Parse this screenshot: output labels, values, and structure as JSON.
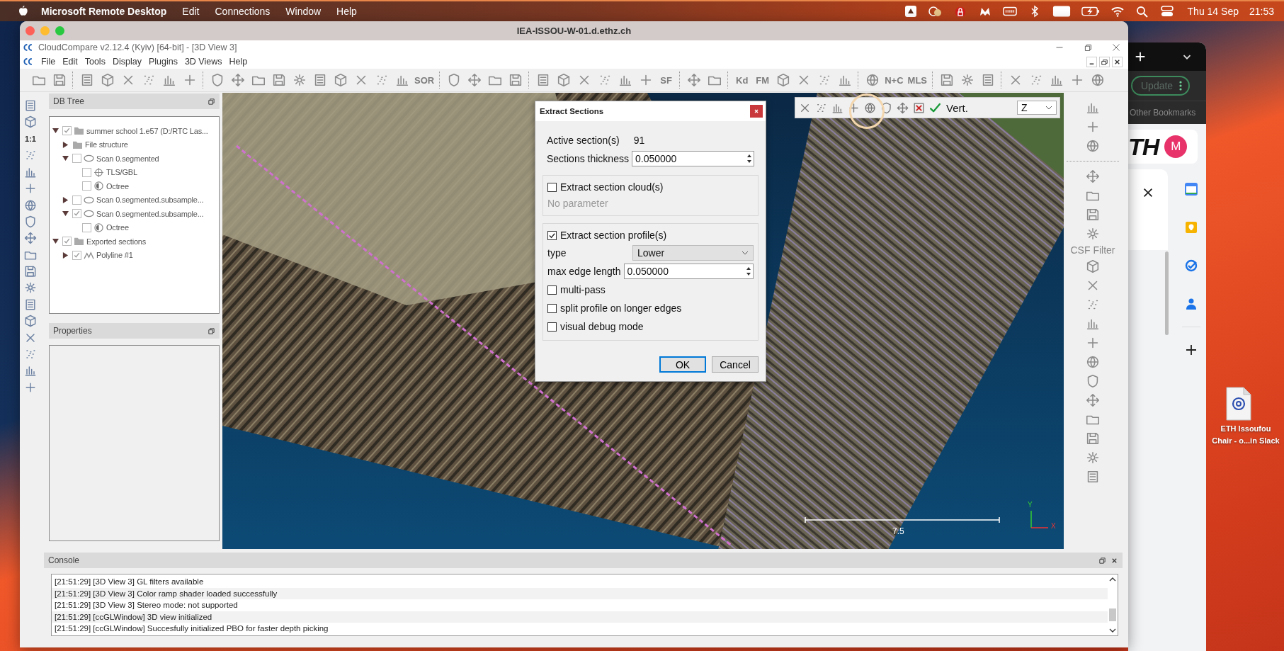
{
  "menu_bar": {
    "app": "Microsoft Remote Desktop",
    "menus": [
      "Edit",
      "Connections",
      "Window",
      "Help"
    ],
    "date": "Thu 14 Sep",
    "time": "21:53"
  },
  "remote_window": {
    "title": "IEA-ISSOU-W-01.d.ethz.ch"
  },
  "app": {
    "title": "CloudCompare v2.12.4 (Kyiv) [64-bit] - [3D View 3]",
    "menus": [
      "File",
      "Edit",
      "Tools",
      "Display",
      "Plugins",
      "3D Views",
      "Help"
    ]
  },
  "main_toolbar": [
    {
      "kind": "icon"
    },
    {
      "kind": "icon"
    },
    {
      "kind": "sep"
    },
    {
      "kind": "icon"
    },
    {
      "kind": "icon"
    },
    {
      "kind": "icon"
    },
    {
      "kind": "icon"
    },
    {
      "kind": "icon"
    },
    {
      "kind": "icon"
    },
    {
      "kind": "sep"
    },
    {
      "kind": "icon"
    },
    {
      "kind": "icon"
    },
    {
      "kind": "icon"
    },
    {
      "kind": "icon"
    },
    {
      "kind": "icon"
    },
    {
      "kind": "icon"
    },
    {
      "kind": "icon"
    },
    {
      "kind": "icon"
    },
    {
      "kind": "icon"
    },
    {
      "kind": "icon"
    },
    {
      "kind": "text",
      "label": "SOR"
    },
    {
      "kind": "sep"
    },
    {
      "kind": "icon"
    },
    {
      "kind": "icon"
    },
    {
      "kind": "icon"
    },
    {
      "kind": "icon"
    },
    {
      "kind": "sep"
    },
    {
      "kind": "icon"
    },
    {
      "kind": "icon"
    },
    {
      "kind": "icon"
    },
    {
      "kind": "icon"
    },
    {
      "kind": "icon"
    },
    {
      "kind": "icon"
    },
    {
      "kind": "text",
      "label": "SF"
    },
    {
      "kind": "sep"
    },
    {
      "kind": "icon"
    },
    {
      "kind": "icon"
    },
    {
      "kind": "sep"
    },
    {
      "kind": "text",
      "label": "Kd"
    },
    {
      "kind": "text",
      "label": "FM"
    },
    {
      "kind": "icon"
    },
    {
      "kind": "icon"
    },
    {
      "kind": "icon"
    },
    {
      "kind": "icon"
    },
    {
      "kind": "sep"
    },
    {
      "kind": "icon"
    },
    {
      "kind": "text",
      "label": "N+C"
    },
    {
      "kind": "text",
      "label": "MLS"
    },
    {
      "kind": "sep"
    },
    {
      "kind": "icon"
    },
    {
      "kind": "icon"
    },
    {
      "kind": "icon"
    },
    {
      "kind": "sep"
    },
    {
      "kind": "icon"
    },
    {
      "kind": "icon"
    },
    {
      "kind": "icon"
    },
    {
      "kind": "icon"
    },
    {
      "kind": "icon"
    }
  ],
  "left_toolbar": [
    {
      "kind": "icon"
    },
    {
      "kind": "icon"
    },
    {
      "kind": "text",
      "label": "1:1"
    },
    {
      "kind": "icon"
    },
    {
      "kind": "icon"
    },
    {
      "kind": "icon"
    },
    {
      "kind": "icon"
    },
    {
      "kind": "icon"
    },
    {
      "kind": "icon"
    },
    {
      "kind": "icon"
    },
    {
      "kind": "icon"
    },
    {
      "kind": "icon"
    },
    {
      "kind": "icon"
    },
    {
      "kind": "icon"
    },
    {
      "kind": "icon"
    },
    {
      "kind": "icon"
    },
    {
      "kind": "icon"
    },
    {
      "kind": "icon"
    }
  ],
  "db_tree": {
    "title": "DB Tree",
    "nodes": [
      {
        "label": "summer school 1.e57 (D:/RTC Las...",
        "kind": "folder",
        "checked": true,
        "expanded": true,
        "children": [
          {
            "label": "File structure",
            "kind": "folder",
            "expanded": false
          },
          {
            "label": "Scan 0.segmented",
            "kind": "cloud",
            "checked": false,
            "expanded": true,
            "children": [
              {
                "label": "TLS/GBL",
                "kind": "sensor",
                "checked": false
              },
              {
                "label": "Octree",
                "kind": "octree",
                "checked": false
              }
            ]
          },
          {
            "label": "Scan 0.segmented.subsample...",
            "kind": "cloud",
            "checked": false,
            "expanded": false
          },
          {
            "label": "Scan 0.segmented.subsample...",
            "kind": "cloud",
            "checked": true,
            "expanded": true,
            "children": [
              {
                "label": "Octree",
                "kind": "octree",
                "checked": false
              }
            ]
          }
        ]
      },
      {
        "label": "Exported sections",
        "kind": "folder",
        "checked": true,
        "expanded": true,
        "children": [
          {
            "label": "Polyline #1",
            "kind": "polyline",
            "checked": true,
            "expanded": false
          }
        ]
      }
    ]
  },
  "properties": {
    "title": "Properties"
  },
  "view": {
    "scale_label": "7.5",
    "axis_y": "Y",
    "axis_x": "X"
  },
  "section_toolbar": {
    "label": "Vert.",
    "axis": "Z"
  },
  "dialog": {
    "title": "Extract Sections",
    "active_label": "Active section(s)",
    "active_value": "91",
    "thickness_label": "Sections thickness",
    "thickness_value": "0.050000",
    "cloud_group": {
      "label": "Extract section cloud(s)",
      "checked": false,
      "note": "No parameter"
    },
    "profile_group": {
      "label": "Extract section profile(s)",
      "checked": true,
      "type_label": "type",
      "type_value": "Lower",
      "edge_label": "max edge length",
      "edge_value": "0.050000",
      "options": [
        {
          "label": "multi-pass",
          "checked": false
        },
        {
          "label": "split profile on longer edges",
          "checked": false
        },
        {
          "label": "visual debug mode",
          "checked": false
        }
      ]
    },
    "buttons": [
      {
        "label": "OK",
        "default": true
      },
      {
        "label": "Cancel",
        "default": false
      }
    ]
  },
  "right_toolbar": [
    {
      "kind": "icon"
    },
    {
      "kind": "icon"
    },
    {
      "kind": "icon"
    },
    {
      "kind": "sep"
    },
    {
      "kind": "icon"
    },
    {
      "kind": "icon"
    },
    {
      "kind": "icon"
    },
    {
      "kind": "icon"
    },
    {
      "kind": "text",
      "label": "CSF Filter"
    },
    {
      "kind": "icon"
    },
    {
      "kind": "icon"
    },
    {
      "kind": "icon"
    },
    {
      "kind": "icon"
    },
    {
      "kind": "icon"
    },
    {
      "kind": "icon"
    },
    {
      "kind": "icon"
    },
    {
      "kind": "icon"
    },
    {
      "kind": "icon"
    },
    {
      "kind": "icon"
    },
    {
      "kind": "icon"
    },
    {
      "kind": "icon"
    }
  ],
  "console": {
    "title": "Console",
    "lines": [
      "[21:51:29] [3D View 3] GL filters available",
      "[21:51:29] [3D View 3] Color ramp shader loaded successfully",
      "[21:51:29] [3D View 3] Stereo mode: not supported",
      "[21:51:29] [ccGLWindow] 3D view initialized",
      "[21:51:29] [ccGLWindow] Succesfully initialized PBO for faster depth picking"
    ]
  },
  "browser": {
    "update_button": "Update",
    "bookmarks": "Other Bookmarks",
    "logo": "TH",
    "avatar": "M"
  },
  "desktop_file": {
    "label_lines": [
      "ETH Issoufou",
      "Chair - o...in Slack"
    ]
  }
}
